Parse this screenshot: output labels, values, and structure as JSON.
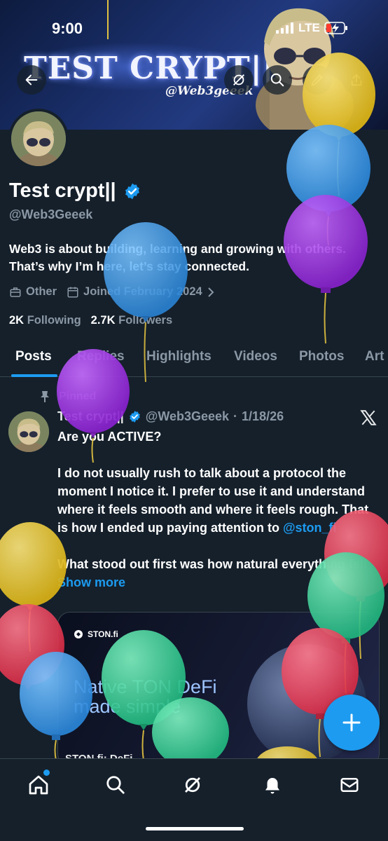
{
  "status_bar": {
    "time": "9:00",
    "network": "LTE"
  },
  "banner": {
    "title": "TEST CRYPT||",
    "handle": "@Web3geeek"
  },
  "header_buttons": [
    "back-icon",
    "refresh-icon",
    "search-icon",
    "edit-icon",
    "share-icon"
  ],
  "profile": {
    "display_name": "Test crypt||",
    "handle": "@Web3Geeek",
    "bio": "Web3 is about building, learning and growing with others. That’s why I’m here, let’s stay connected.",
    "category": "Other",
    "joined": "Joined February 2024",
    "following_count": "2K",
    "following_label": "Following",
    "followers_count": "2.7K",
    "followers_label": "Followers"
  },
  "tabs": [
    "Posts",
    "Replies",
    "Highlights",
    "Videos",
    "Photos",
    "Art"
  ],
  "active_tab": "Posts",
  "pinned_post": {
    "pinned_label": "Pinned",
    "author_name": "Test crypt||",
    "author_handle": "@Web3Geeek",
    "separator": "·",
    "date": "1/18/26",
    "text_intro": "Are you ACTIVE?\n\nI do not usually rush to talk about a protocol the moment I notice it. I prefer to use it and understand where it feels smooth and where it feels rough. That is how I ended up paying attention to ",
    "mention": "@ston_fi",
    "text_outro": "\n\nWhat stood out first was how natural everything felt ",
    "show_more": "Show more",
    "card": {
      "brand": "STON.fi",
      "headline_line1": "Native TON DeFi",
      "headline_line2": "made simple",
      "footer": "STON.fi: DeFi ... "
    }
  },
  "fab_label": "+",
  "bottom_nav": [
    "home-icon",
    "search-icon",
    "grok-icon",
    "notifications-icon",
    "messages-icon"
  ],
  "colors": {
    "background": "#15202b",
    "accent": "#1d9bf0",
    "text_secondary": "#8b98a5"
  }
}
